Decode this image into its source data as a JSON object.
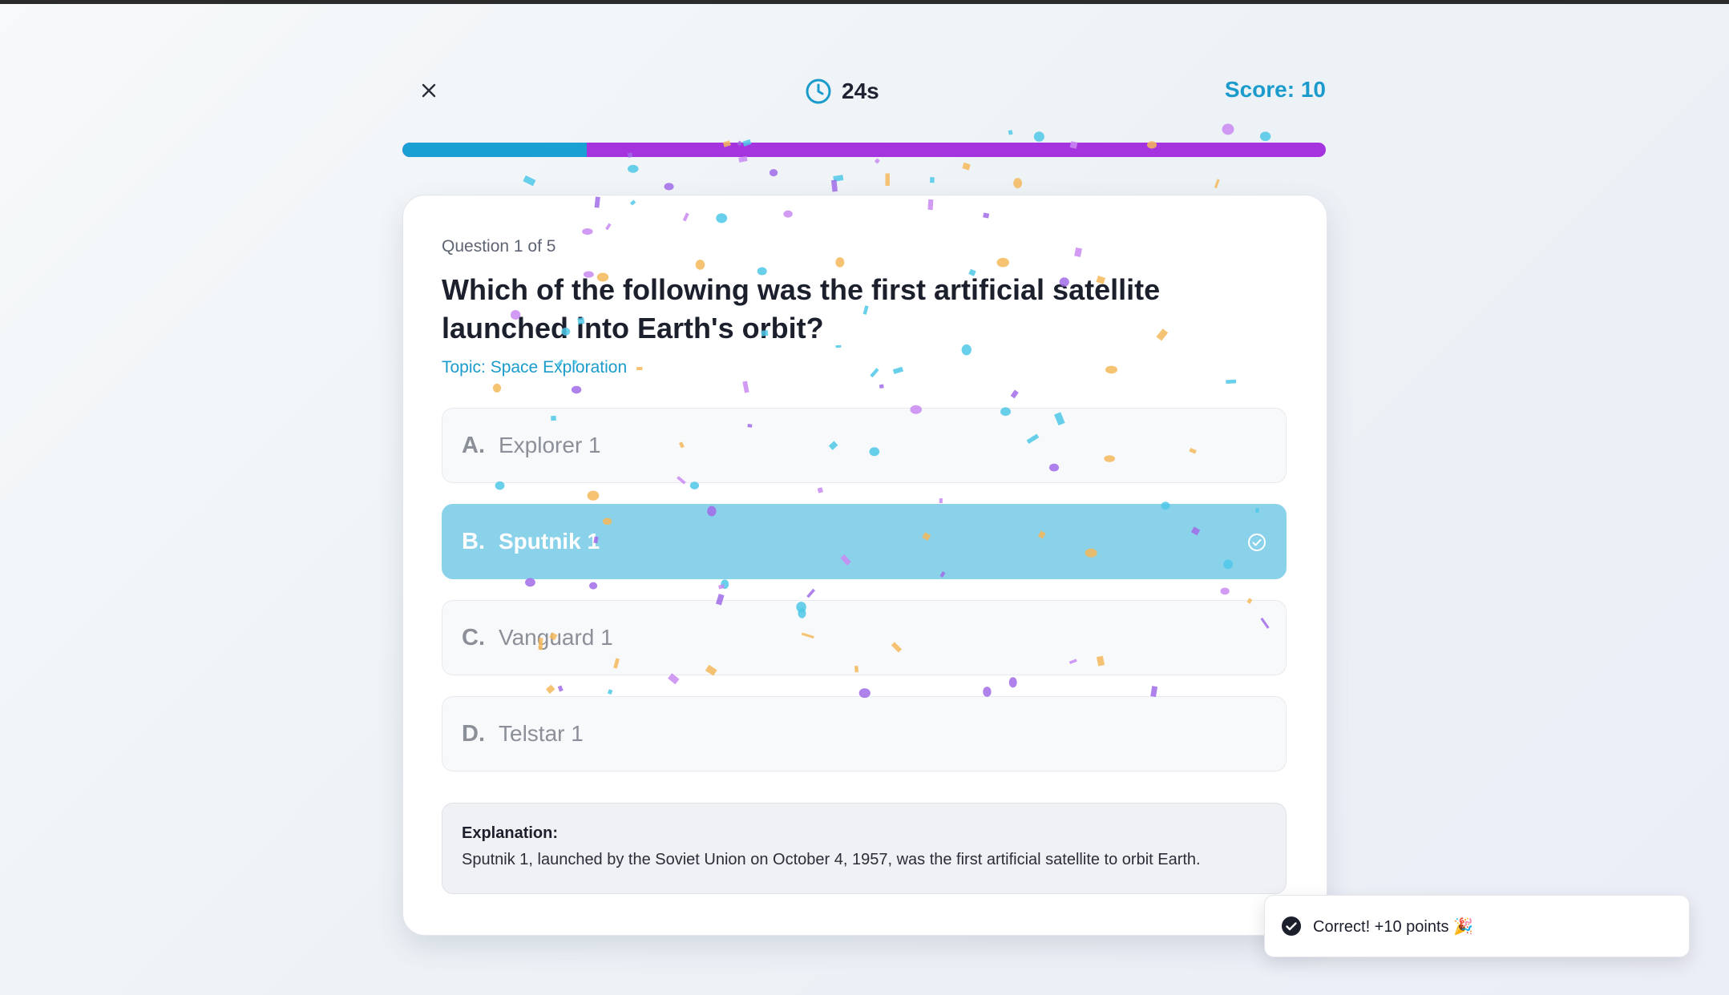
{
  "header": {
    "close_label": "close",
    "timer": "24s",
    "score_label": "Score:",
    "score_value": "10"
  },
  "progress": {
    "fraction": 0.2
  },
  "question": {
    "counter": "Question 1 of 5",
    "text": "Which of the following was the first artificial satellite launched into Earth's orbit?",
    "topic": "Topic: Space Exploration"
  },
  "options": [
    {
      "letter": "A.",
      "text": "Explorer 1",
      "selected": false
    },
    {
      "letter": "B.",
      "text": "Sputnik 1",
      "selected": true
    },
    {
      "letter": "C.",
      "text": "Vanguard 1",
      "selected": false
    },
    {
      "letter": "D.",
      "text": "Telstar 1",
      "selected": false
    }
  ],
  "explanation": {
    "title": "Explanation:",
    "text": "Sputnik 1, launched by the Soviet Union on October 4, 1957, was the first artificial satellite to orbit Earth."
  },
  "toast": {
    "text": "Correct! +10 points 🎉"
  },
  "colors": {
    "accent": "#1a9bcc",
    "progress_track": "#a534de",
    "selected_option": "#8ad1ea",
    "confetti": [
      "#4fc8e8",
      "#c98af2",
      "#f5b95a",
      "#a06be8"
    ]
  }
}
